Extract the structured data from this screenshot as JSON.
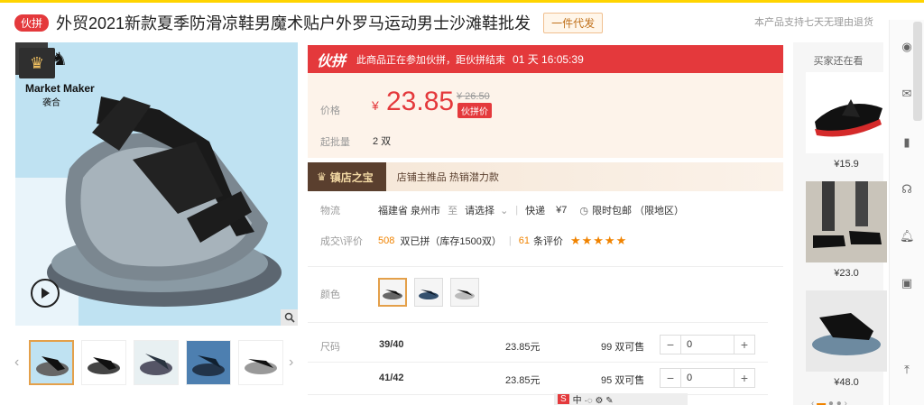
{
  "header": {
    "badge": "伙拼",
    "title": "外贸2021新款夏季防滑凉鞋男魔术贴户外罗马运动男士沙滩鞋批发",
    "tag": "一件代发",
    "note": "本产品支持七天无理由退货"
  },
  "gallery": {
    "brand_logo": "Market Maker",
    "brand_sub": "袭合",
    "zoom_icon": "search-icon",
    "play_icon": "play-icon",
    "thumbnails": [
      "thumb-1",
      "thumb-2",
      "thumb-3",
      "thumb-4",
      "thumb-5"
    ]
  },
  "promo": {
    "logo": "伙拼",
    "text": "此商品正在参加伙拼，距伙拼结束",
    "countdown": "01 天 16:05:39"
  },
  "price": {
    "label": "价格",
    "currency": "¥",
    "value": "23.85",
    "original": "¥ 26.50",
    "tag": "伙拼价",
    "moq_label": "起批量",
    "moq": "2 双"
  },
  "shop": {
    "badge": "镇店之宝",
    "text": "店铺主推品  热销潜力款"
  },
  "logistics": {
    "label": "物流",
    "from": "福建省 泉州市",
    "to_word": "至",
    "to": "请选择",
    "express": "快递",
    "fee": "¥7",
    "free": "限时包邮  （限地区）"
  },
  "deals": {
    "label": "成交\\评价",
    "count": "508",
    "count_text": "双已拼（库存1500双）",
    "reviews": "61",
    "reviews_text": "条评价",
    "stars": "★★★★★"
  },
  "color": {
    "label": "颜色",
    "options": [
      "黑灰",
      "蓝色",
      "黑白"
    ]
  },
  "sizes": {
    "label": "尺码",
    "rows": [
      {
        "size": "39/40",
        "price": "23.85元",
        "stock": "99 双可售",
        "qty": "0"
      },
      {
        "size": "41/42",
        "price": "23.85元",
        "stock": "95 双可售",
        "qty": "0"
      }
    ]
  },
  "recommend": {
    "title": "买家还在看",
    "items": [
      {
        "price": "¥15.9"
      },
      {
        "price": "¥23.0"
      },
      {
        "price": "¥48.0"
      }
    ]
  },
  "colors": {
    "accent": "#e4393c",
    "brand_yellow": "#ffd400",
    "orange": "#f08300"
  }
}
